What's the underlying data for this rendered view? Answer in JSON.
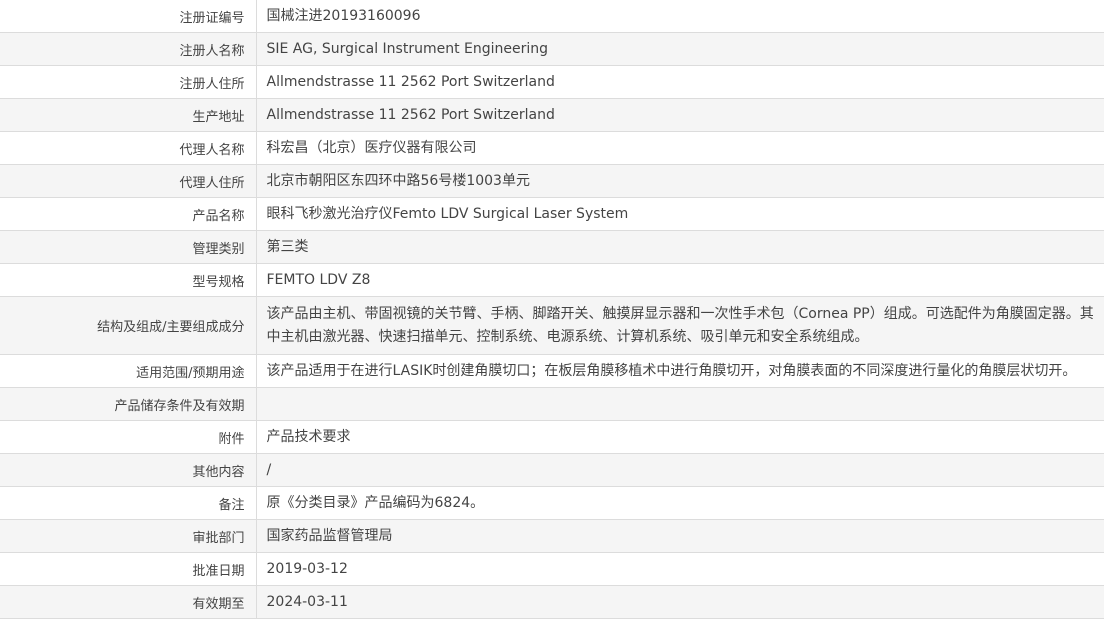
{
  "rows": [
    {
      "label": "注册证编号",
      "value": "国械注进20193160096"
    },
    {
      "label": "注册人名称",
      "value": "SIE AG, Surgical Instrument Engineering"
    },
    {
      "label": "注册人住所",
      "value": "Allmendstrasse 11 2562 Port Switzerland"
    },
    {
      "label": "生产地址",
      "value": "Allmendstrasse 11 2562 Port Switzerland"
    },
    {
      "label": "代理人名称",
      "value": "科宏昌（北京）医疗仪器有限公司"
    },
    {
      "label": "代理人住所",
      "value": "北京市朝阳区东四环中路56号楼1003单元"
    },
    {
      "label": "产品名称",
      "value": "眼科飞秒激光治疗仪Femto LDV Surgical Laser System"
    },
    {
      "label": "管理类别",
      "value": "第三类"
    },
    {
      "label": "型号规格",
      "value": "FEMTO LDV Z8"
    },
    {
      "label": "结构及组成/主要组成成分",
      "value": "该产品由主机、带固视镜的关节臂、手柄、脚踏开关、触摸屏显示器和一次性手术包（Cornea PP）组成。可选配件为角膜固定器。其中主机由激光器、快速扫描单元、控制系统、电源系统、计算机系统、吸引单元和安全系统组成。"
    },
    {
      "label": "适用范围/预期用途",
      "value": "该产品适用于在进行LASIK时创建角膜切口；在板层角膜移植术中进行角膜切开，对角膜表面的不同深度进行量化的角膜层状切开。"
    },
    {
      "label": "产品储存条件及有效期",
      "value": ""
    },
    {
      "label": "附件",
      "value": "产品技术要求"
    },
    {
      "label": "其他内容",
      "value": "/"
    },
    {
      "label": "备注",
      "value": "原《分类目录》产品编码为6824。"
    },
    {
      "label": "审批部门",
      "value": "国家药品监督管理局"
    },
    {
      "label": "批准日期",
      "value": "2019-03-12"
    },
    {
      "label": "有效期至",
      "value": "2024-03-11"
    }
  ]
}
